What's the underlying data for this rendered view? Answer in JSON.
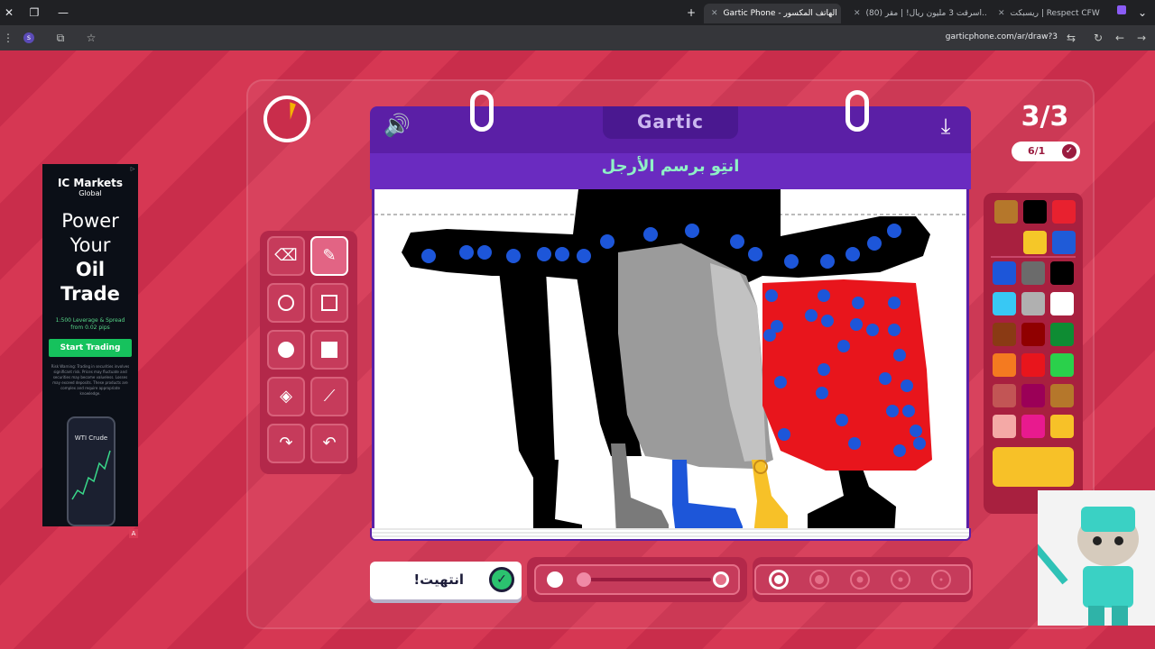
{
  "browser": {
    "tabs": [
      {
        "title": "ريسبكت | Respect CFW",
        "active": false
      },
      {
        "title": "(80) اسرقت 3 مليون ريال! | مقر...",
        "active": false
      },
      {
        "title": "Gartic Phone - الهاتف المكسور",
        "active": true
      }
    ],
    "url": "garticphone.com/ar/draw?3",
    "profile_letter": "s"
  },
  "game": {
    "logo": "Gartic",
    "prompt": "انتِو برسم الأرجل",
    "round": "3/3",
    "progress": "6/1",
    "done_label": "انتهيت!",
    "timer_fraction": 0.06,
    "stroke_opacity_fraction": 0.05,
    "selected_size_index": 0
  },
  "palette": {
    "colors": [
      "#b5772b",
      "#000000",
      "#e8212f",
      "#f5c728",
      "#1f5bd8",
      "#1d56d9",
      "#6b6b6b",
      "#000000",
      "#38c8f4",
      "#b0b0b0",
      "#ffffff",
      "#8a3a14",
      "#900000",
      "#0e8c33",
      "#f47a20",
      "#e8151c",
      "#2ad04b",
      "#c25555",
      "#9b0057",
      "#b5772b",
      "#f4a9a6",
      "#e81a8e",
      "#f7c128"
    ],
    "selected": "#f7c128"
  },
  "ad": {
    "brand": "IC Markets",
    "brand_sub": "Global",
    "headline_1": "Power",
    "headline_2": "Your",
    "headline_3": "Oil",
    "headline_4": "Trade",
    "sub": "1:500 Leverage & Spread from 0.02 pips",
    "cta": "Start Trading",
    "risk": "Risk Warning: Trading in securities involves significant risk. Prices may fluctuate and securities may become valueless. Losses may exceed deposits. These products are complex and require appropriate knowledge.",
    "phone_label": "WTI Crude"
  },
  "colors": {
    "bg": "#d93a55",
    "board": "#5b1fa6",
    "prompt": "#8ff1c6"
  }
}
